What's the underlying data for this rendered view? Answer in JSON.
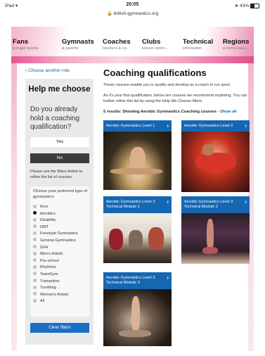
{
  "status_bar": {
    "device": "iPad",
    "wifi_icon": "wifi-icon",
    "time": "20:05",
    "url": "british-gymnastics.org",
    "battery": "43%"
  },
  "nav": {
    "items": [
      {
        "title": "Fans",
        "sub": "& major events"
      },
      {
        "title": "Gymnasts",
        "sub": "& parents"
      },
      {
        "title": "Coaches",
        "sub": "teachers & vo..."
      },
      {
        "title": "Clubs",
        "sub": "leisure centre..."
      },
      {
        "title": "Technical",
        "sub": "information"
      },
      {
        "title": "Regions",
        "sub": "& home coun..."
      }
    ]
  },
  "sidebar": {
    "back_link": "Choose another role",
    "title": "Help me choose",
    "question": "Do you already hold a coaching qualification?",
    "yes_label": "Yes",
    "no_label": "No",
    "note": "Please use the filters below to refine the list of courses.",
    "filter_title": "Choose your preferred type of gymnastics:",
    "filters": [
      {
        "label": "Acro",
        "selected": false
      },
      {
        "label": "Aerobics",
        "selected": true
      },
      {
        "label": "Disability",
        "selected": false
      },
      {
        "label": "DMT",
        "selected": false
      },
      {
        "label": "Freestyle Gymnastics",
        "selected": false
      },
      {
        "label": "General Gymnastics",
        "selected": false
      },
      {
        "label": "GFA",
        "selected": false
      },
      {
        "label": "Men's Artistic",
        "selected": false
      },
      {
        "label": "Pre-school",
        "selected": false
      },
      {
        "label": "Rhythmic",
        "selected": false
      },
      {
        "label": "TeamGym",
        "selected": false
      },
      {
        "label": "Trampoline",
        "selected": false
      },
      {
        "label": "Tumbling",
        "selected": false
      },
      {
        "label": "Women's Artistic",
        "selected": false
      },
      {
        "label": "All",
        "selected": false
      }
    ],
    "clear_label": "Clear filters"
  },
  "main": {
    "title": "Coaching qualifications",
    "intro1": "These courses enable you to qualify and develop as a coach in our sport.",
    "intro2": "As it's your first qualification, below are courses we recommend exploring. You can further refine this list by using the Help Me Choose filters.",
    "results_text": "5 results: Showing Aerobic Gymnastics Coaching courses - ",
    "show_all": "Show all",
    "courses": [
      {
        "title": "Aerobic Gymnastics Level 1"
      },
      {
        "title": "Aerobic Gymnastics Level 2"
      },
      {
        "title": "Aerobic Gymnastics Level 3 Technical Module 1"
      },
      {
        "title": "Aerobic Gymnastics Level 3 Technical Module 2"
      },
      {
        "title": "Aerobic Gymnastics Level 3 Technical Module 3"
      }
    ]
  },
  "colors": {
    "accent_blue": "#1567b3",
    "link_blue": "#1666b9",
    "brand_pink": "#e5558f"
  }
}
